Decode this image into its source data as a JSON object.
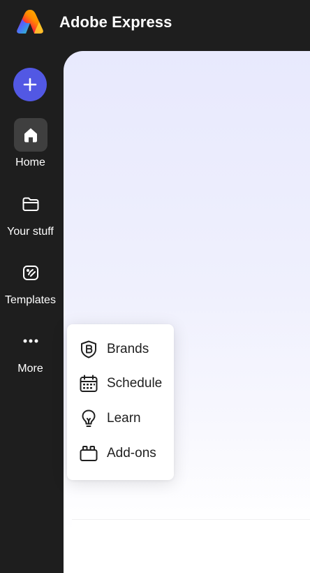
{
  "app": {
    "title": "Adobe Express",
    "logo_icon": "adobe-express-logo"
  },
  "sidebar": {
    "create_icon": "plus-icon",
    "create_color": "#5258e4",
    "items": [
      {
        "label": "Home",
        "icon": "home-icon",
        "active": true
      },
      {
        "label": "Your stuff",
        "icon": "folder-icon",
        "active": false
      },
      {
        "label": "Templates",
        "icon": "templates-icon",
        "active": false
      },
      {
        "label": "More",
        "icon": "more-icon",
        "active": false
      }
    ]
  },
  "more_menu": {
    "items": [
      {
        "label": "Brands",
        "icon": "brand-icon"
      },
      {
        "label": "Schedule",
        "icon": "calendar-icon"
      },
      {
        "label": "Learn",
        "icon": "lightbulb-icon"
      },
      {
        "label": "Add-ons",
        "icon": "addons-icon"
      }
    ]
  },
  "colors": {
    "sidebar_bg": "#1e1e1e",
    "accent": "#5258e4",
    "active_item_bg": "#3f3f3f",
    "main_bg_top": "#e8e9fd"
  }
}
